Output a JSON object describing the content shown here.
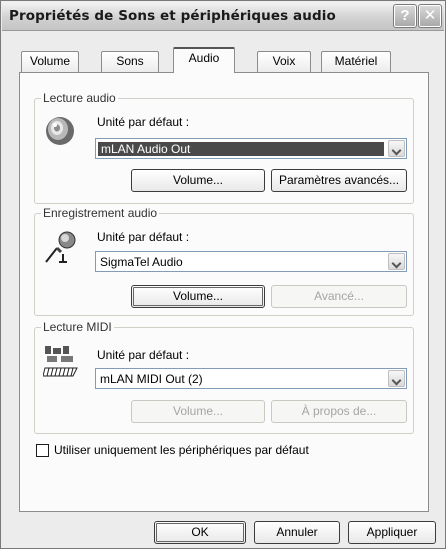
{
  "window": {
    "title": "Propriétés de Sons et périphériques audio",
    "help_glyph": "?",
    "close_glyph": "✕"
  },
  "tabs": [
    {
      "label": "Volume",
      "active": false
    },
    {
      "label": "Sons",
      "active": false
    },
    {
      "label": "Audio",
      "active": true
    },
    {
      "label": "Voix",
      "active": false
    },
    {
      "label": "Matériel",
      "active": false
    }
  ],
  "playback": {
    "group_title": "Lecture audio",
    "icon": "speaker-icon",
    "device_label": "Unité par défaut :",
    "device_value": "mLAN Audio Out",
    "volume_button": "Volume...",
    "advanced_button": "Paramètres avancés..."
  },
  "recording": {
    "group_title": "Enregistrement audio",
    "icon": "microphone-icon",
    "device_label": "Unité par défaut :",
    "device_value": "SigmaTel Audio",
    "volume_button": "Volume...",
    "advanced_button": "Avancé..."
  },
  "midi": {
    "group_title": "Lecture MIDI",
    "icon": "midi-keyboard-icon",
    "device_label": "Unité par défaut :",
    "device_value": "mLAN MIDI Out (2)",
    "volume_button": "Volume...",
    "about_button": "À propos de..."
  },
  "default_only_checkbox": {
    "label": "Utiliser uniquement les périphériques par défaut",
    "checked": false
  },
  "footer": {
    "ok": "OK",
    "cancel": "Annuler",
    "apply": "Appliquer"
  }
}
